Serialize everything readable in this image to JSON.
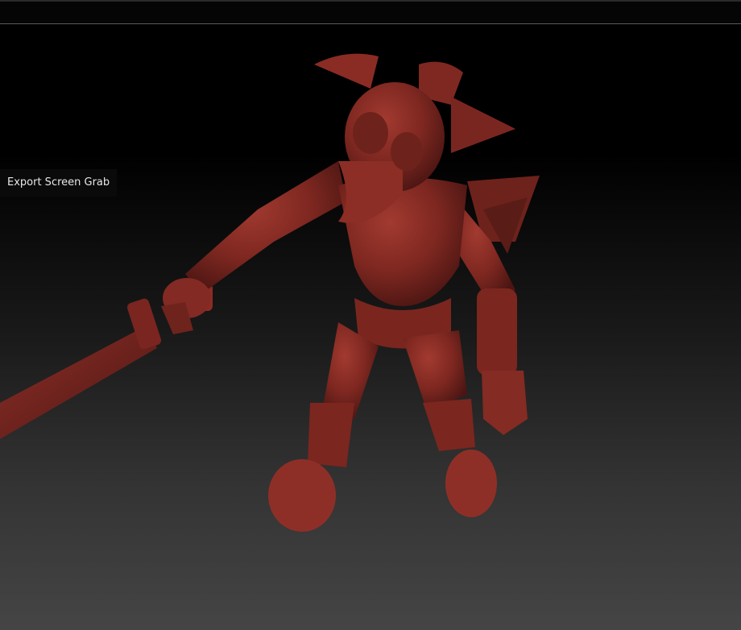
{
  "tooltip": {
    "text": "Export Screen Grab"
  },
  "model": {
    "material_color": "#8a2a22"
  }
}
